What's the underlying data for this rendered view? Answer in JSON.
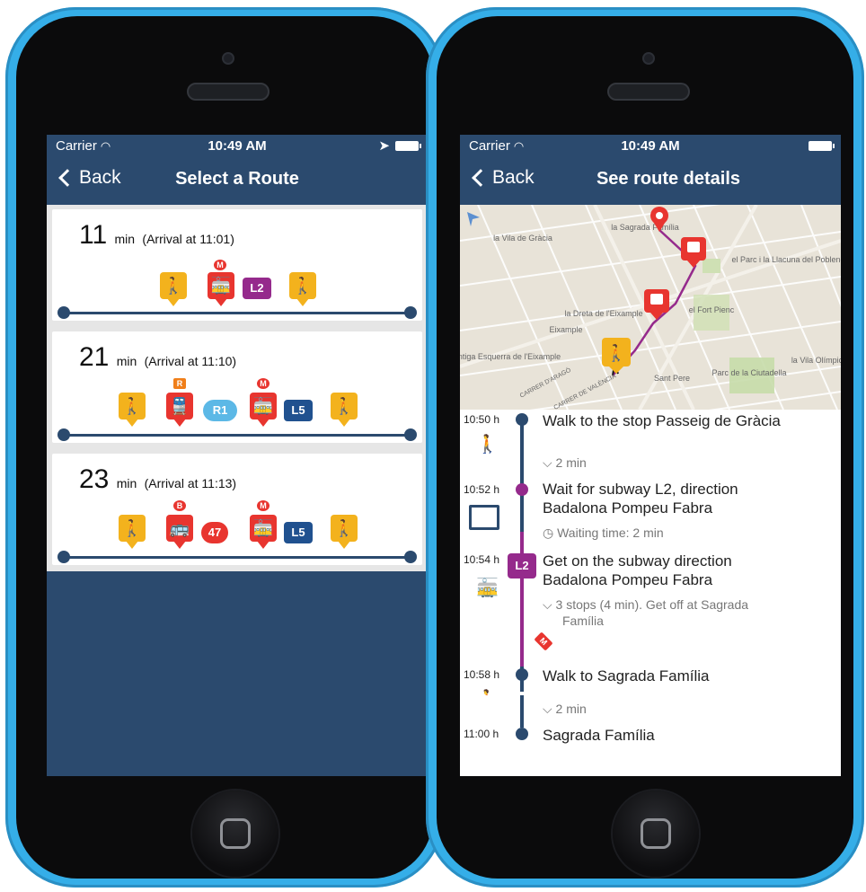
{
  "left_screen": {
    "status": {
      "carrier": "Carrier",
      "time": "10:49 AM"
    },
    "nav": {
      "back": "Back",
      "title": "Select a Route"
    },
    "routes": [
      {
        "minutes": "11",
        "unit": "min",
        "arrival": "(Arrival at 11:01)",
        "badge": "L2"
      },
      {
        "minutes": "21",
        "unit": "min",
        "arrival": "(Arrival at 11:10)",
        "tag1": "R",
        "badge1": "R1",
        "tag2": "M",
        "badge2": "L5"
      },
      {
        "minutes": "23",
        "unit": "min",
        "arrival": "(Arrival at 11:13)",
        "tag1": "B",
        "badge1": "47",
        "tag2": "M",
        "badge2": "L5"
      }
    ],
    "route1_tag": "M"
  },
  "right_screen": {
    "status": {
      "carrier": "Carrier",
      "time": "10:49 AM"
    },
    "nav": {
      "back": "Back",
      "title": "See route details"
    },
    "map": {
      "labels": [
        "la Vila de Gràcia",
        "la Sagrada Família",
        "el Parc i la Llacuna del Poblenou",
        "la Dreta de l'Eixample",
        "el Fort Pienc",
        "Eixample",
        "Antiga Esquerra de l'Eixample",
        "Sant Pere",
        "Parc de la Ciutadella",
        "la Vila Olímpica",
        "CARRER D'ARAGÓ",
        "CARRER DE VALÈNCIA"
      ]
    },
    "steps": [
      {
        "time": "10:50 h",
        "title": "Walk to the stop Passeig de Gràcia",
        "sub": "2 min"
      },
      {
        "time": "10:52 h",
        "title_l1": "Wait for subway L2, direction",
        "title_l2": "Badalona Pompeu Fabra",
        "sub": "Waiting time: 2 min"
      },
      {
        "time": "10:54 h",
        "badge": "L2",
        "title_l1": "Get on the subway direction",
        "title_l2": "Badalona Pompeu Fabra",
        "sub_l1": "3 stops (4 min). Get off at Sagrada",
        "sub_l2": "Família",
        "metro": "M"
      },
      {
        "time": "10:58 h",
        "title": "Walk to Sagrada Família",
        "sub": "2 min"
      },
      {
        "time": "11:00 h",
        "title": "Sagrada Família"
      }
    ]
  },
  "colors": {
    "nav": "#2b4a6e",
    "phone": "#35aee8",
    "walk": "#f3b21d",
    "subway": "#e8352f",
    "line_L2": "#952a8c",
    "line_L5": "#20518f",
    "line_R1": "#5cb8e6"
  }
}
